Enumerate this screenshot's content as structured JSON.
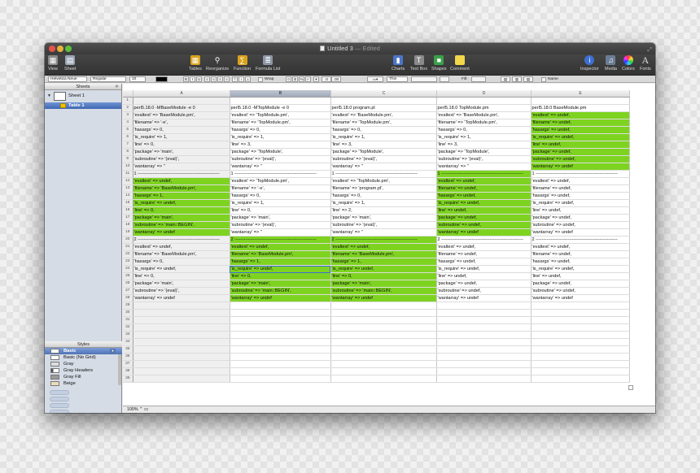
{
  "window": {
    "title": "Untitled 3",
    "status": "— Edited"
  },
  "toolbar": {
    "left": [
      {
        "label": "View",
        "icon": "view-icon"
      },
      {
        "label": "Sheet",
        "icon": "sheet-icon"
      }
    ],
    "middle": [
      {
        "label": "Tables",
        "icon": "tables-icon"
      },
      {
        "label": "Reorganize",
        "icon": "reorganize-icon"
      },
      {
        "label": "Function",
        "icon": "function-icon"
      },
      {
        "label": "Formula List",
        "icon": "formula-list-icon"
      }
    ],
    "insert": [
      {
        "label": "Charts",
        "icon": "charts-icon"
      },
      {
        "label": "Text Box",
        "icon": "text-box-icon"
      },
      {
        "label": "Shapes",
        "icon": "shapes-icon"
      },
      {
        "label": "Comment",
        "icon": "comment-icon"
      }
    ],
    "right": [
      {
        "label": "Inspector",
        "icon": "inspector-icon"
      },
      {
        "label": "Media",
        "icon": "media-icon"
      },
      {
        "label": "Colors",
        "icon": "colors-icon"
      },
      {
        "label": "Fonts",
        "icon": "fonts-icon",
        "glyph": "A"
      }
    ]
  },
  "format_bar": {
    "font_family": "Helvetica Neue",
    "font_style": "Regular",
    "font_size": "10",
    "wrap_label": "Wrap",
    "stroke_style": "Thin",
    "fill_label": "Fill:",
    "name_label": "Name"
  },
  "sidebar": {
    "sheets_header": "Sheets",
    "sheets": [
      {
        "label": "Sheet 1",
        "tables": [
          "Table 1"
        ]
      }
    ],
    "styles_header": "Styles",
    "styles": [
      {
        "label": "Basic",
        "selected": true
      },
      {
        "label": "Basic (No Grid)",
        "selected": false
      },
      {
        "label": "Gray",
        "selected": false
      },
      {
        "label": "Gray Headers",
        "selected": false
      },
      {
        "label": "Gray Fill",
        "selected": false
      },
      {
        "label": "Beige",
        "selected": false
      }
    ]
  },
  "colors": {
    "highlight_green": "#7ed321",
    "selection_blue": "#3b6fd6"
  },
  "status_bar": {
    "zoom": "100%"
  },
  "sheet": {
    "columns": [
      "A",
      "B",
      "C",
      "D",
      "E"
    ],
    "selected_column": "B",
    "selected_cell": "B24",
    "rows": [
      {
        "n": "1",
        "cells": [
          "",
          "",
          "",
          "",
          ""
        ]
      },
      {
        "n": "2",
        "cells": [
          "perl5.18.0 -MBaseModule -e 0",
          "perl5.18.0 -MTopModule -e 0",
          "perl5.18.0 program.pl",
          "perl5.18.0 TopModule.pm",
          "perl5.18.0 BaseModule.pm"
        ]
      },
      {
        "n": "3",
        "cells": [
          "'evaltext' => 'BaseModule.pm',",
          "'evaltext' => 'TopModule.pm',",
          "'evaltext' => 'BaseModule.pm',",
          "'evaltext' => 'BaseModule.pm',",
          "'evaltext' => undef,"
        ]
      },
      {
        "n": "4",
        "cells": [
          "'filename' => '-e',",
          "'filename' => 'TopModule.pm',",
          "'filename' => 'TopModule.pm',",
          "'filename' => 'TopModule.pm',",
          "'filename' => undef,"
        ]
      },
      {
        "n": "5",
        "cells": [
          "'hasargs' => 0,",
          "'hasargs' => 0,",
          "'hasargs' => 0,",
          "'hasargs' => 0,",
          "'hasargs' => undef,"
        ]
      },
      {
        "n": "6",
        "cells": [
          "'is_require' => 1,",
          "'is_require' => 1,",
          "'is_require' => 1,",
          "'is_require' => 1,",
          "'is_require' => undef,"
        ]
      },
      {
        "n": "7",
        "cells": [
          "'line' => 0,",
          "'line' => 3,",
          "'line' => 3,",
          "'line' => 3,",
          "'line' => undef,"
        ]
      },
      {
        "n": "8",
        "cells": [
          "'package' => 'main',",
          "'package' => 'TopModule',",
          "'package' => 'TopModule',",
          "'package' => 'TopModule',",
          "'package' => undef,"
        ]
      },
      {
        "n": "9",
        "cells": [
          "'subroutine' => '(eval)',",
          "'subroutine' => '(eval)',",
          "'subroutine' => '(eval)',",
          "'subroutine' => '(eval)',",
          "'subroutine' => undef,"
        ]
      },
      {
        "n": "10",
        "cells": [
          "'wantarray' => ''",
          "'wantarray' => ''",
          "'wantarray' => ''",
          "'wantarray' => ''",
          "'wantarray' => undef"
        ]
      },
      {
        "n": "11",
        "cells": [
          "1 ------------------------------------------------------",
          "1 ------------------------------------------------------",
          "1 ------------------------------------------------------",
          "1 ------------------------------------------------------",
          "1 ------------------------------------------------------"
        ]
      },
      {
        "n": "12",
        "cells": [
          "'evaltext' => undef,",
          "'evaltext' => 'TopModule.pm',",
          "'evaltext' => 'TopModule.pm',",
          "'evaltext' => undef,",
          "'evaltext' => undef,"
        ]
      },
      {
        "n": "13",
        "cells": [
          "'filename' => 'BaseModule.pm',",
          "'filename' => '-e',",
          "'filename' => 'program.pl',",
          "'filename' => undef,",
          "'filename' => undef,"
        ]
      },
      {
        "n": "14",
        "cells": [
          "'hasargs' => 1,",
          "'hasargs' => 0,",
          "'hasargs' => 0,",
          "'hasargs' => undef,",
          "'hasargs' => undef,"
        ]
      },
      {
        "n": "15",
        "cells": [
          "'is_require' => undef,",
          "'is_require' => 1,",
          "'is_require' => 1,",
          "'is_require' => undef,",
          "'is_require' => undef,"
        ]
      },
      {
        "n": "16",
        "cells": [
          "'line' => 0,",
          "'line' => 0,",
          "'line' => 2,",
          "'line' => undef,",
          "'line' => undef,"
        ]
      },
      {
        "n": "17",
        "cells": [
          "'package' => 'main',",
          "'package' => 'main',",
          "'package' => 'main',",
          "'package' => undef,",
          "'package' => undef,"
        ]
      },
      {
        "n": "18",
        "cells": [
          "'subroutine' => 'main::BEGIN',",
          "'subroutine' => '(eval)',",
          "'subroutine' => '(eval)',",
          "'subroutine' => undef,",
          "'subroutine' => undef,"
        ]
      },
      {
        "n": "19",
        "cells": [
          "'wantarray' => undef",
          "'wantarray' => ''",
          "'wantarray' => ''",
          "'wantarray' => undef",
          "'wantarray' => undef"
        ]
      },
      {
        "n": "20",
        "cells": [
          "2 ------------------------------------------------------",
          "2 ------------------------------------------------------",
          "2 ------------------------------------------------------",
          "2 ------------------------------------------------------",
          "2 ------------------------------------------------------"
        ]
      },
      {
        "n": "21",
        "cells": [
          "'evaltext' => undef,",
          "'evaltext' => undef,",
          "'evaltext' => undef,",
          "'evaltext' => undef,",
          "'evaltext' => undef,"
        ]
      },
      {
        "n": "22",
        "cells": [
          "'filename' => 'BaseModule.pm',",
          "'filename' => 'BaseModule.pm',",
          "'filename' => 'BaseModule.pm',",
          "'filename' => undef,",
          "'filename' => undef,"
        ]
      },
      {
        "n": "23",
        "cells": [
          "'hasargs' => 0,",
          "'hasargs' => 1,",
          "'hasargs' => 1,",
          "'hasargs' => undef,",
          "'hasargs' => undef,"
        ]
      },
      {
        "n": "24",
        "cells": [
          "'is_require' => undef,",
          "'is_require' => undef,",
          "'is_require' => undef,",
          "'is_require' => undef,",
          "'is_require' => undef,"
        ]
      },
      {
        "n": "25",
        "cells": [
          "'line' => 0,",
          "'line' => 0,",
          "'line' => 0,",
          "'line' => undef,",
          "'line' => undef,"
        ]
      },
      {
        "n": "26",
        "cells": [
          "'package' => 'main',",
          "'package' => 'main',",
          "'package' => 'main',",
          "'package' => undef,",
          "'package' => undef,"
        ]
      },
      {
        "n": "27",
        "cells": [
          "'subroutine' => '(eval)',",
          "'subroutine' => 'main::BEGIN',",
          "'subroutine' => 'main::BEGIN',",
          "'subroutine' => undef,",
          "'subroutine' => undef,"
        ]
      },
      {
        "n": "28",
        "cells": [
          "'wantarray' => undef",
          "'wantarray' => undef",
          "'wantarray' => undef",
          "'wantarray' => undef",
          "'wantarray' => undef"
        ]
      }
    ],
    "empty_row_numbers": [
      "29",
      "30",
      "31",
      "32",
      "33",
      "34",
      "35",
      "36",
      "37",
      "38",
      "39"
    ],
    "green_cells": {
      "A": [
        "12",
        "13",
        "14",
        "15",
        "16",
        "17",
        "18",
        "19"
      ],
      "B": [
        "20",
        "21",
        "22",
        "23",
        "24",
        "25",
        "26",
        "27",
        "28"
      ],
      "C": [
        "20",
        "21",
        "22",
        "23",
        "24",
        "25",
        "26",
        "27",
        "28"
      ],
      "D": [
        "11",
        "12",
        "13",
        "14",
        "15",
        "16",
        "17",
        "18",
        "19"
      ],
      "E": [
        "3",
        "4",
        "5",
        "6",
        "7",
        "8",
        "9",
        "10"
      ]
    }
  }
}
